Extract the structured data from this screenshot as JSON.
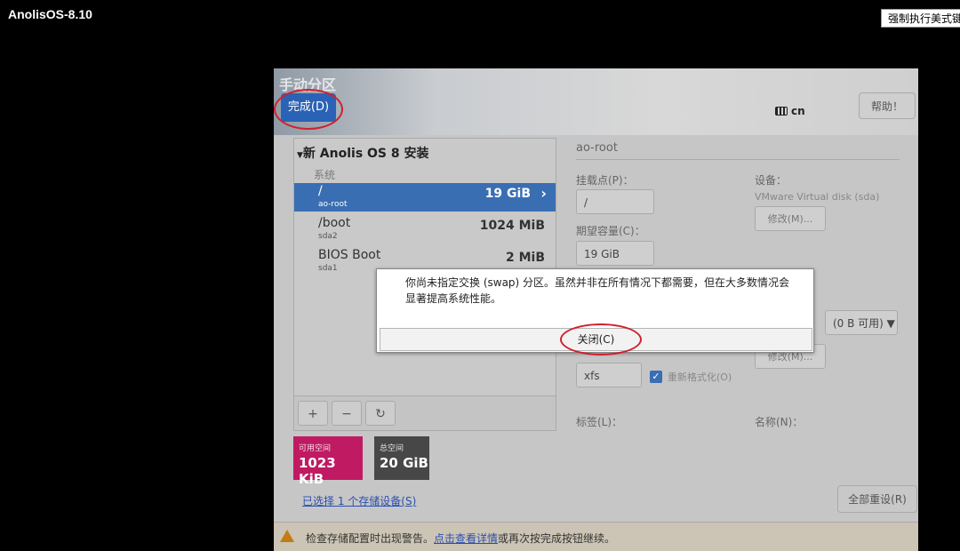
{
  "vm": {
    "title": "AnolisOS-8.10",
    "force_button": "强制执行美式键"
  },
  "header": {
    "page_title": "手动分区",
    "done_button": "完成(D)",
    "keyboard_layout": "cn",
    "help_button": "帮助！"
  },
  "tree": {
    "install_title": "新 Anolis OS 8 安装",
    "group": "系统",
    "mounts": [
      {
        "mount": "/",
        "device": "ao-root",
        "size": "19 GiB",
        "selected": true
      },
      {
        "mount": "/boot",
        "device": "sda2",
        "size": "1024 MiB",
        "selected": false
      },
      {
        "mount": "BIOS Boot",
        "device": "sda1",
        "size": "2 MiB",
        "selected": false
      }
    ]
  },
  "toolbar": {
    "add": "+",
    "remove": "−",
    "refresh": "↻"
  },
  "space": {
    "available_label": "可用空间",
    "available_value": "1023 KiB",
    "total_label": "总空间",
    "total_value": "20 GiB",
    "available_color": "#c01a63",
    "total_color": "#474747"
  },
  "storage_link": "已选择 1 个存储设备(S)",
  "reset_button": "全部重设(R)",
  "warning": {
    "prefix": "检查存储配置时出现警告。",
    "link": "点击查看详情",
    "suffix": "或再次按完成按钮继续。"
  },
  "details": {
    "title": "ao-root",
    "mount_label": "挂载点(P)：",
    "mount_value": "/",
    "capacity_label": "期望容量(C)：",
    "capacity_value": "19 GiB",
    "device_label": "设备：",
    "device_value": "VMware Virtual disk (sda)",
    "modify1": "修改(M)...",
    "vg_value": "(0 B 可用) ▼",
    "modify2": "修改(M)...",
    "fs_value": "xfs",
    "reformat_label": "重新格式化(O)",
    "tag_label": "标签(L)：",
    "name_label": "名称(N)："
  },
  "dialog": {
    "message": "你尚未指定交换 (swap) 分区。虽然并非在所有情况下都需要，但在大多数情况会显著提高系统性能。",
    "close_button": "关闭(C)"
  }
}
